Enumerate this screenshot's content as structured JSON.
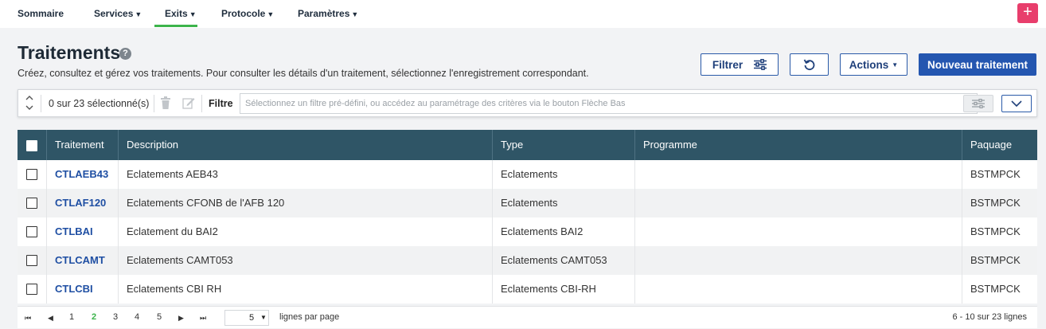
{
  "nav": {
    "items": [
      {
        "label": "Sommaire",
        "caret": ""
      },
      {
        "label": "Services",
        "caret": "▼"
      },
      {
        "label": "Exits",
        "caret": "▼"
      },
      {
        "label": "Protocole",
        "caret": "▼"
      },
      {
        "label": "Paramètres",
        "caret": "▼"
      }
    ],
    "active": "Exits",
    "plus": "+"
  },
  "header": {
    "title": "Traitements",
    "help": "?",
    "description": "Créez, consultez et gérez vos traitements. Pour consulter les détails d'un traitement, sélectionnez l'enregistrement correspondant."
  },
  "toolbar": {
    "filter_label": "Filtrer",
    "actions_label": "Actions",
    "new_label": "Nouveau traitement"
  },
  "filterbar": {
    "selection_count": "0 sur 23 sélectionné(s)",
    "filter_label": "Filtre",
    "filter_placeholder": "Sélectionnez un filtre pré-défini, ou accédez au paramétrage des critères via le bouton Flèche Bas"
  },
  "table": {
    "columns": [
      "Traitement",
      "Description",
      "Type",
      "Programme",
      "Paquage"
    ],
    "rows": [
      {
        "code": "CTLAEB43",
        "description": "Eclatements AEB43",
        "type": "Eclatements",
        "programme": "",
        "paquage": "BSTMPCK"
      },
      {
        "code": "CTLAF120",
        "description": "Eclatements CFONB de l'AFB 120",
        "type": "Eclatements",
        "programme": "",
        "paquage": "BSTMPCK"
      },
      {
        "code": "CTLBAI",
        "description": "Eclatement du BAI2",
        "type": "Eclatements BAI2",
        "programme": "",
        "paquage": "BSTMPCK"
      },
      {
        "code": "CTLCAMT",
        "description": "Eclatements CAMT053",
        "type": "Eclatements CAMT053",
        "programme": "",
        "paquage": "BSTMPCK"
      },
      {
        "code": "CTLCBI",
        "description": "Eclatements CBI RH",
        "type": "Eclatements CBI-RH",
        "programme": "",
        "paquage": "BSTMPCK"
      }
    ]
  },
  "pager": {
    "first": "⏮",
    "prev": "◀",
    "pages": [
      "1",
      "2",
      "3",
      "4",
      "5"
    ],
    "current_page": "2",
    "next": "▶",
    "last": "⏭",
    "page_size": "5",
    "page_size_label": "lignes par page",
    "range": "6 - 10 sur 23 lignes"
  },
  "colors": {
    "nav_active": "#3cb44b",
    "header_bg": "#2f5566",
    "primary": "#2456b0",
    "plus": "#e83e6c",
    "link": "#1f4fa3"
  }
}
